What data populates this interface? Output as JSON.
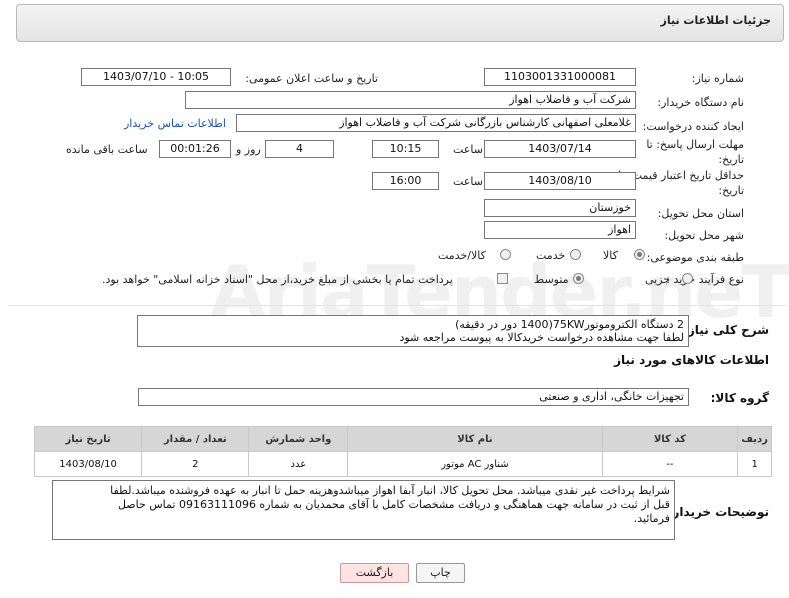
{
  "header": {
    "title": "جزئیات اطلاعات نیاز"
  },
  "fields": {
    "need_number_label": "شماره نیاز:",
    "need_number": "1103001331000081",
    "announce_datetime_label": "تاریخ و ساعت اعلان عمومی:",
    "announce_datetime": "1403/07/10 - 10:05",
    "buyer_org_label": "نام دستگاه خریدار:",
    "buyer_org": "شرکت آب و فاضلاب اهواز",
    "requester_label": "ایجاد کننده درخواست:",
    "requester": "غلامعلی اصفهانی کارشناس بازرگانی شرکت آب و فاضلاب اهواز",
    "contact_link": "اطلاعات تماس خریدار",
    "reply_deadline_label": "مهلت ارسال پاسخ: تا تاریخ:",
    "reply_date": "1403/07/14",
    "time_label": "ساعت",
    "reply_time": "10:15",
    "days_value": "4",
    "days_label": "روز و",
    "remaining_time": "00:01:26",
    "remaining_label": "ساعت باقی مانده",
    "price_validity_label": "حداقل تاریخ اعتبار قیمت: تا تاریخ:",
    "price_date": "1403/08/10",
    "price_time_label": "ساعت",
    "price_time": "16:00",
    "province_label": "استان محل تحویل:",
    "province": "خوزستان",
    "city_label": "شهر محل تحویل:",
    "city": "اهواز",
    "category_label": "طبقه بندی موضوعی:",
    "category_options": [
      "کالا",
      "خدمت",
      "کالا/خدمت"
    ],
    "process_label": "نوع فرآیند خرید :",
    "process_options": [
      "جزیی",
      "متوسط"
    ],
    "treasury_note": "پرداخت تمام یا بخشی از مبلغ خرید،از محل \"اسناد خزانه اسلامی\" خواهد بود."
  },
  "summary": {
    "label": "شرح کلی نیاز:",
    "line1": "2 دستگاه الکتروموتور75KW(1400 دور در دقیقه)",
    "line2": "لطفا جهت مشاهده درخواست خریدکالا به پیوست مراجعه شود"
  },
  "goods_section": {
    "title": "اطلاعات کالاهای مورد نیاز",
    "group_label": "گروه کالا:",
    "group_value": "تجهیزات خانگی، اداری و صنعتی"
  },
  "table": {
    "headers": [
      "ردیف",
      "کد کالا",
      "نام کالا",
      "واحد شمارش",
      "تعداد / مقدار",
      "تاریخ نیاز"
    ],
    "rows": [
      [
        "1",
        "--",
        "موتور AC شناور",
        "عدد",
        "2",
        "1403/08/10"
      ]
    ]
  },
  "buyer_notes": {
    "label": "توضیحات خریدار:",
    "line1": "شرایط پرداخت غیر نقدی میباشد. محل تحویل کالا، انبار آبفا اهواز میباشدوهزینه حمل تا انبار به عهده فروشنده میباشد.لطفا",
    "line2": "قبل از ثبت در سامانه جهت هماهنگی و دریافت مشخصات کامل با آقای  محمدیان به شماره 09163111096 تماس حاصل",
    "line3": "فرمائید."
  },
  "buttons": {
    "print": "چاپ",
    "back": "بازگشت"
  },
  "watermark": "AriaTender.neT",
  "colors": {
    "link": "#1a4fc4",
    "back_button_bg": "#fde3e3",
    "header_bg": "#e8e8e8"
  }
}
